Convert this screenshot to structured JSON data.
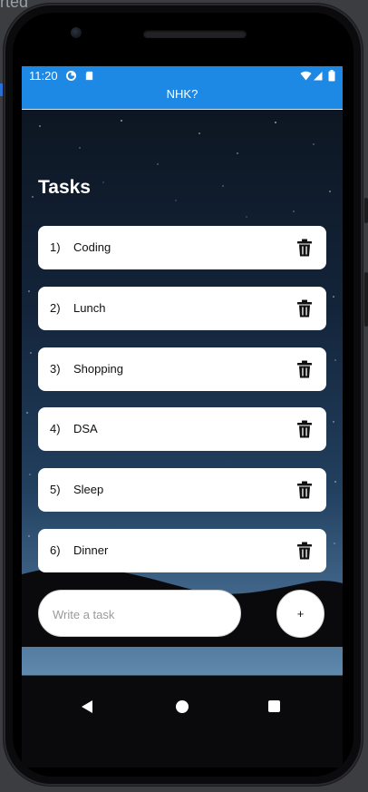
{
  "background": {
    "partial_text": "rted"
  },
  "status_bar": {
    "time": "11:20",
    "icons": [
      "data-saver-icon",
      "sd-card-icon",
      "wifi-icon",
      "signal-icon",
      "battery-icon"
    ]
  },
  "app_bar": {
    "title": "NHK?",
    "color": "#1e88e5"
  },
  "main": {
    "heading": "Tasks",
    "tasks": [
      {
        "number": "1)",
        "text": "Coding"
      },
      {
        "number": "2)",
        "text": "Lunch"
      },
      {
        "number": "3)",
        "text": "Shopping"
      },
      {
        "number": "4)",
        "text": "DSA"
      },
      {
        "number": "5)",
        "text": "Sleep"
      },
      {
        "number": "6)",
        "text": "Dinner"
      }
    ]
  },
  "composer": {
    "placeholder": "Write a task",
    "add_label": "+"
  },
  "nav_bar": {
    "icons": [
      "back-icon",
      "home-icon",
      "recents-icon"
    ]
  }
}
